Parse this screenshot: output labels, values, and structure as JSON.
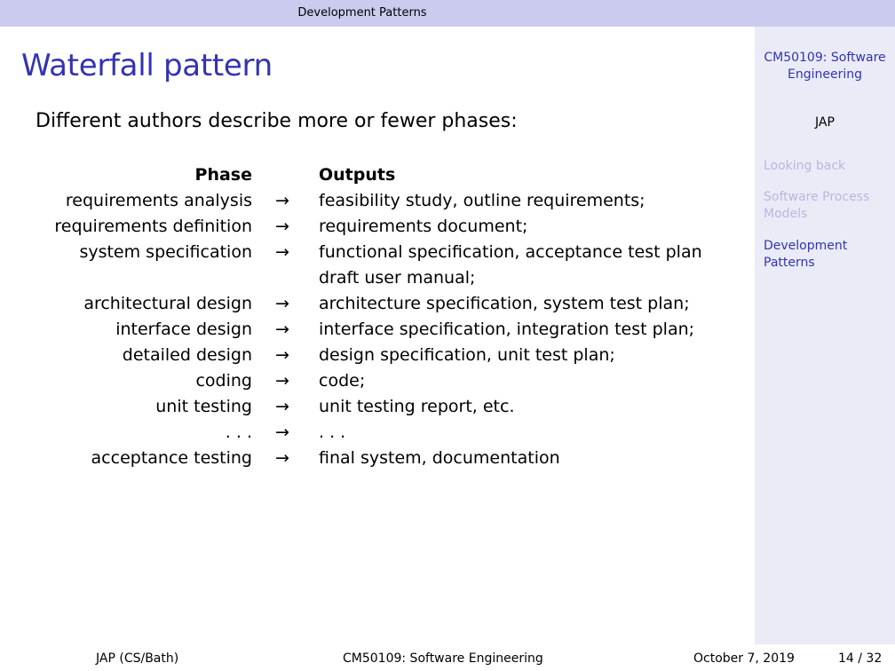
{
  "topbar": {
    "section": "Development Patterns"
  },
  "sidebar": {
    "title": "CM50109: Software Engineering",
    "author": "JAP",
    "items": [
      {
        "label": "Looking back",
        "active": false
      },
      {
        "label": "Software Process Models",
        "active": false
      },
      {
        "label": "Development Patterns",
        "active": true
      }
    ]
  },
  "slide": {
    "title": "Waterfall pattern",
    "intro": "Different authors describe more or fewer phases:",
    "header": {
      "phase": "Phase",
      "outputs": "Outputs"
    },
    "arrow": "→",
    "rows": [
      {
        "phase": "requirements analysis",
        "output": "feasibility study, outline requirements;"
      },
      {
        "phase": "requirements definition",
        "output": "requirements document;"
      },
      {
        "phase": "system specification",
        "output": "functional specification, acceptance test plan"
      },
      {
        "phase": "",
        "output": "draft user manual;"
      },
      {
        "phase": "architectural design",
        "output": "architecture specification, system test plan;"
      },
      {
        "phase": "interface design",
        "output": "interface specification, integration test plan;"
      },
      {
        "phase": "detailed design",
        "output": "design specification, unit test plan;"
      },
      {
        "phase": "coding",
        "output": "code;"
      },
      {
        "phase": "unit testing",
        "output": "unit testing report, etc."
      },
      {
        "phase": ". . .",
        "output": ". . ."
      },
      {
        "phase": "acceptance testing",
        "output": "final system, documentation"
      }
    ]
  },
  "footer": {
    "author": "JAP   (CS/Bath)",
    "course": "CM50109: Software Engineering",
    "date": "October 7, 2019",
    "page": "14 / 32"
  }
}
